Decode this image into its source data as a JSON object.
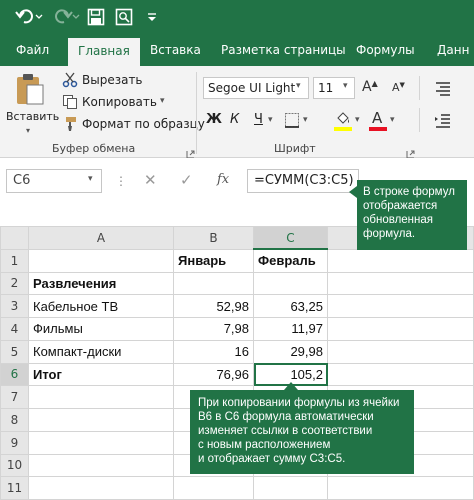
{
  "tabs": {
    "file": "Файл",
    "home": "Главная",
    "insert": "Вставка",
    "layout": "Разметка страницы",
    "formulas": "Формулы",
    "data": "Данн"
  },
  "ribbon": {
    "paste": "Вставить",
    "cut": "Вырезать",
    "copy": "Копировать",
    "format_painter": "Формат по образцу",
    "clipboard_group": "Буфер обмена",
    "font_name": "Segoe UI Light",
    "font_size": "11",
    "bold": "Ж",
    "italic": "К",
    "underline": "Ч",
    "font_group": "Шрифт",
    "grow_font": "A",
    "shrink_font": "A",
    "font_color_letter": "A",
    "fill_color": "#ffff00",
    "font_color": "#e81123"
  },
  "formula_bar": {
    "name_box": "C6",
    "fx": "fx",
    "formula": "=СУММ(C3:C5)"
  },
  "columns": [
    "A",
    "B",
    "C"
  ],
  "rows": [
    {
      "n": "1",
      "a": "",
      "b": "Январь",
      "c": "Февраль"
    },
    {
      "n": "2",
      "a": "Развлечения",
      "b": "",
      "c": ""
    },
    {
      "n": "3",
      "a": "Кабельное ТВ",
      "b": "52,98",
      "c": "63,25"
    },
    {
      "n": "4",
      "a": "Фильмы",
      "b": "7,98",
      "c": "11,97"
    },
    {
      "n": "5",
      "a": "Компакт-диски",
      "b": "16",
      "c": "29,98"
    },
    {
      "n": "6",
      "a": "Итог",
      "b": "76,96",
      "c": "105,2"
    },
    {
      "n": "7",
      "a": "",
      "b": "",
      "c": ""
    },
    {
      "n": "8",
      "a": "",
      "b": "",
      "c": ""
    },
    {
      "n": "9",
      "a": "",
      "b": "",
      "c": ""
    },
    {
      "n": "10",
      "a": "",
      "b": "",
      "c": ""
    },
    {
      "n": "11",
      "a": "",
      "b": "",
      "c": ""
    }
  ],
  "callouts": {
    "top": [
      "В строке формул",
      "отображается",
      "обновленная",
      "формула."
    ],
    "bottom": [
      "При копировании формулы из ячейки",
      "B6 в C6 формула автоматически",
      "изменяет ссылки в соответствии",
      "с новым расположением",
      "и отображает сумму C3:C5."
    ]
  }
}
